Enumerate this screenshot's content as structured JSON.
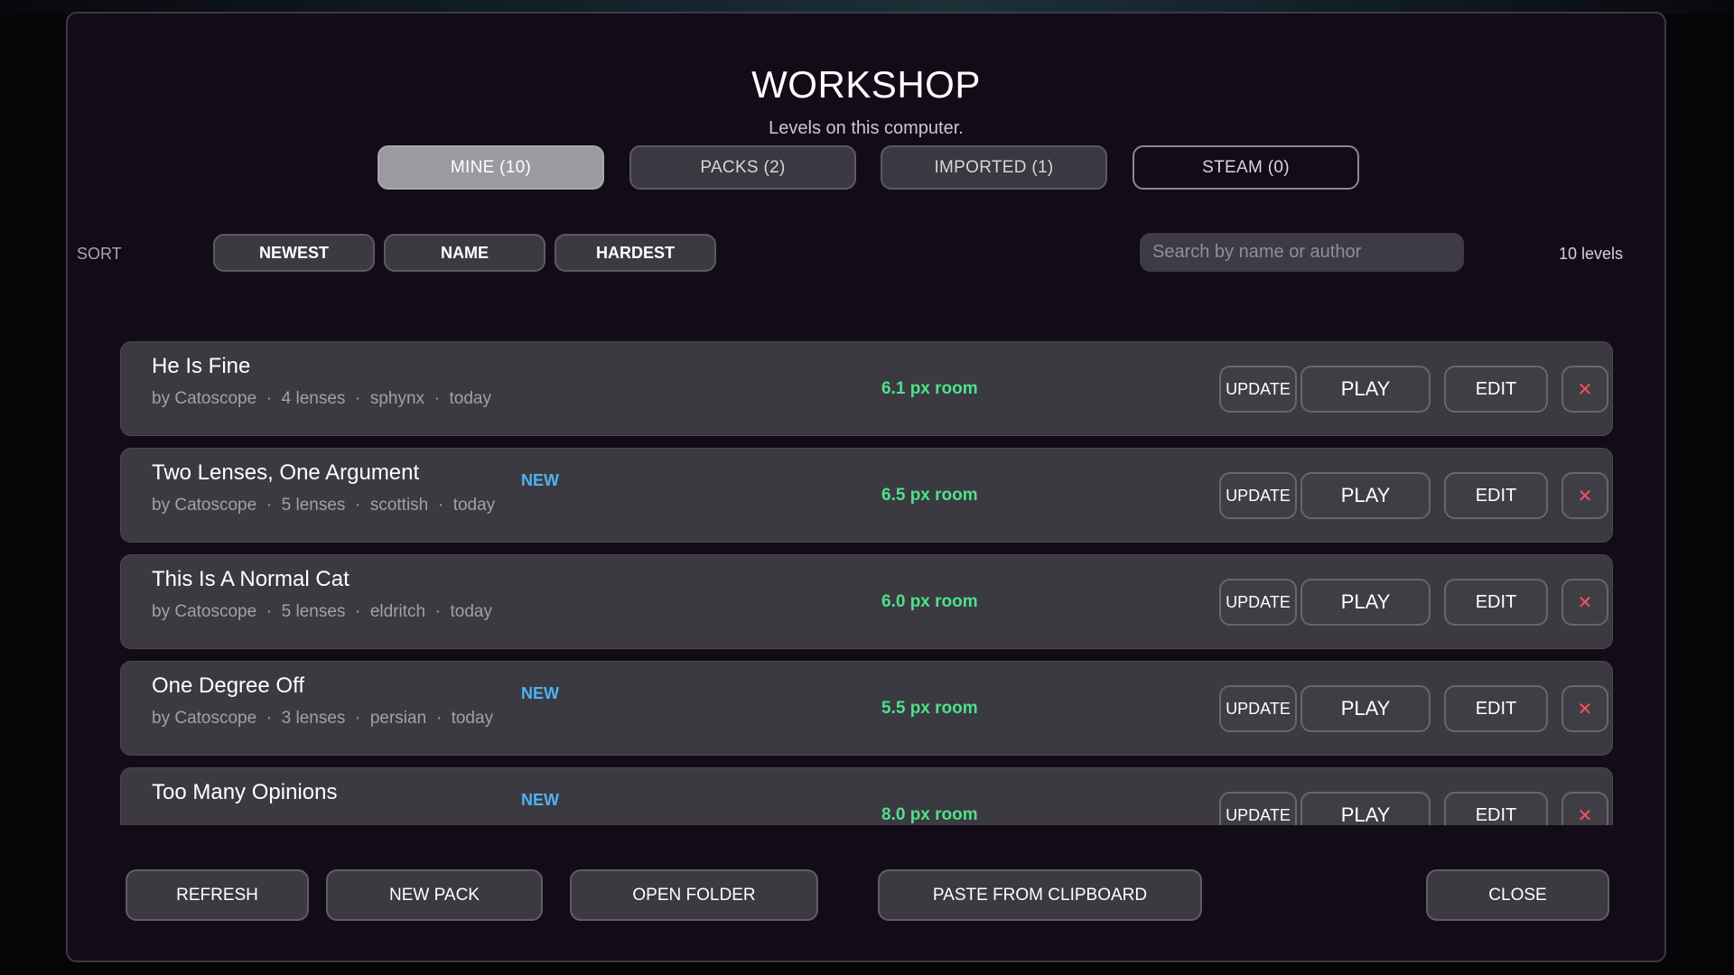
{
  "header": {
    "title": "WORKSHOP",
    "subtitle": "Levels on this computer."
  },
  "tabs": [
    {
      "label": "MINE (10)",
      "state": "active"
    },
    {
      "label": "PACKS (2)",
      "state": "normal"
    },
    {
      "label": "IMPORTED (1)",
      "state": "normal"
    },
    {
      "label": "STEAM (0)",
      "state": "outline"
    }
  ],
  "sort": {
    "label": "SORT",
    "options": [
      "NEWEST",
      "NAME",
      "HARDEST"
    ]
  },
  "search": {
    "placeholder": "Search by name or author",
    "value": ""
  },
  "level_count": "10 levels",
  "row_buttons": {
    "update": "UPDATE",
    "play": "PLAY",
    "edit": "EDIT",
    "delete": "✕"
  },
  "levels": [
    {
      "name": "He Is Fine",
      "meta": "by Catoscope  ·  4 lenses  ·  sphynx  ·  today",
      "new": "",
      "room": "6.1 px room"
    },
    {
      "name": "Two Lenses, One Argument",
      "meta": "by Catoscope  ·  5 lenses  ·  scottish  ·  today",
      "new": "NEW",
      "room": "6.5 px room"
    },
    {
      "name": "This Is A Normal Cat",
      "meta": "by Catoscope  ·  5 lenses  ·  eldritch  ·  today",
      "new": "",
      "room": "6.0 px room"
    },
    {
      "name": "One Degree Off",
      "meta": "by Catoscope  ·  3 lenses  ·  persian  ·  today",
      "new": "NEW",
      "room": "5.5 px room"
    },
    {
      "name": "Too Many Opinions",
      "meta": "",
      "new": "NEW",
      "room": "8.0 px room"
    }
  ],
  "footer": {
    "refresh": "REFRESH",
    "new_pack": "NEW PACK",
    "open_folder": "OPEN FOLDER",
    "paste": "PASTE FROM CLIPBOARD",
    "close": "CLOSE"
  },
  "colors": {
    "panel_bg": "#130c18",
    "row_bg": "#3b3a41",
    "new_badge": "#4fb2f0",
    "room_text": "#4fe08a",
    "delete_x": "#ff4f5e"
  }
}
